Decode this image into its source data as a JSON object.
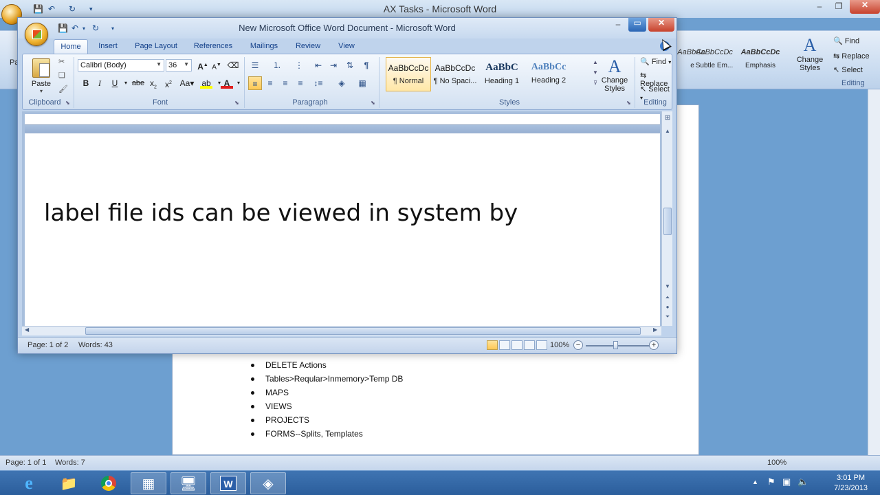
{
  "bg_window": {
    "title": "AX Tasks - Microsoft Word",
    "styles": [
      {
        "preview": "AaBbCc.",
        "name": "e"
      },
      {
        "preview": "AaBbCcDc",
        "name": "Subtle Em..."
      },
      {
        "preview": "AaBbCcDc",
        "name": "Emphasis"
      }
    ],
    "change_styles_label": "Change Styles",
    "editing": {
      "find": "Find",
      "replace": "Replace",
      "select": "Select",
      "group": "Editing"
    },
    "list_items": [
      "DELETE Actions",
      "Tables>Reqular>Inmemory>Temp DB",
      "MAPS",
      "VIEWS",
      "PROJECTS",
      "FORMS--Splits, Templates"
    ],
    "status": {
      "page": "Page: 1 of 1",
      "words": "Words: 7",
      "zoom": "100%"
    },
    "left_partial": "Pa"
  },
  "taskbar": {
    "clock_time": "3:01 PM",
    "clock_date": "7/23/2013",
    "apps": [
      "internet-explorer",
      "file-explorer",
      "chrome",
      "ax-app",
      "remote-desktop",
      "word",
      "other-app"
    ]
  },
  "fg_window": {
    "title": "New Microsoft Office Word Document - Microsoft Word",
    "tabs": [
      "Home",
      "Insert",
      "Page Layout",
      "References",
      "Mailings",
      "Review",
      "View"
    ],
    "active_tab": "Home",
    "clipboard": {
      "paste": "Paste",
      "group": "Clipboard"
    },
    "font": {
      "name": "Calibri (Body)",
      "size": "36",
      "group": "Font"
    },
    "paragraph": {
      "group": "Paragraph"
    },
    "styles": {
      "items": [
        {
          "preview": "AaBbCcDc",
          "name": "¶ Normal"
        },
        {
          "preview": "AaBbCcDc",
          "name": "¶ No Spaci..."
        },
        {
          "preview": "AaBbC",
          "name": "Heading 1"
        },
        {
          "preview": "AaBbCc",
          "name": "Heading 2"
        }
      ],
      "change_styles": "Change Styles",
      "group": "Styles"
    },
    "editing": {
      "find": "Find",
      "replace": "Replace",
      "select": "Select",
      "group": "Editing"
    },
    "document_text": "label file ids can be viewed in system by",
    "status": {
      "page": "Page: 1 of 2",
      "words": "Words: 43",
      "zoom": "100%"
    }
  },
  "colors": {
    "accent": "#2b5797",
    "close_red": "#c7412c",
    "selected_style": "#ffe7a8"
  }
}
